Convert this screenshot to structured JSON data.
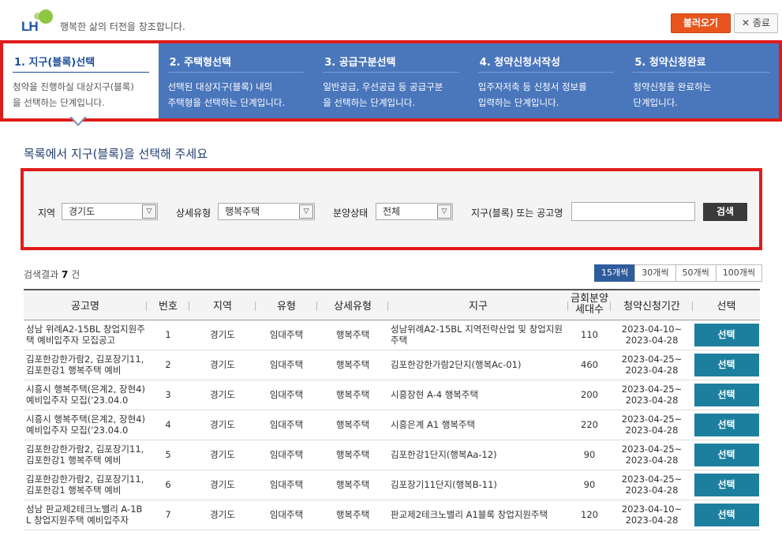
{
  "header": {
    "logo_text": "LH",
    "slogan": "행복한 삶의 터전을 창조합니다.",
    "load_button": "불러오기",
    "close_button": "종료"
  },
  "steps": [
    {
      "title": "1. 지구(블록)선택",
      "desc1": "청약을 진행하실 대상지구(블록)",
      "desc2": "을 선택하는 단계입니다.",
      "active": true
    },
    {
      "title": "2. 주택형선택",
      "desc1": "선택된 대상지구(블록) 내의",
      "desc2": "주택형을 선택하는 단계입니다.",
      "active": false
    },
    {
      "title": "3. 공급구분선택",
      "desc1": "일반공급, 우선공급 등 공급구분",
      "desc2": "을 선택하는 단계입니다.",
      "active": false
    },
    {
      "title": "4. 청약신청서작성",
      "desc1": "입주자저축 등 신청서 정보를",
      "desc2": "입력하는 단계입니다.",
      "active": false
    },
    {
      "title": "5. 청약신청완료",
      "desc1": "청약신청을 완료하는",
      "desc2": "단계입니다.",
      "active": false
    }
  ],
  "section_title": "목록에서 지구(블록)을 선택해 주세요",
  "search": {
    "region_label": "지역",
    "region_value": "경기도",
    "type_label": "상세유형",
    "type_value": "행복주택",
    "status_label": "분양상태",
    "status_value": "전체",
    "keyword_label": "지구(블록) 또는 공고명",
    "keyword_value": "",
    "search_button": "검색"
  },
  "result": {
    "prefix": "검색결과",
    "count": "7",
    "suffix": "건"
  },
  "page_sizes": [
    "15개씩",
    "30개씩",
    "50개씩",
    "100개씩"
  ],
  "table": {
    "headers": {
      "notice": "공고명",
      "no": "번호",
      "region": "지역",
      "type": "유형",
      "subtype": "상세유형",
      "district": "지구",
      "units1": "금회분양",
      "units2": "세대수",
      "period": "청약신청기간",
      "select": "선택"
    },
    "rows": [
      {
        "notice": "성남 위례A2-15BL 창업지원주택 예비입주자 모집공고",
        "no": "1",
        "region": "경기도",
        "type": "임대주택",
        "subtype": "행복주택",
        "district": "성남위례A2-15BL 지역전략산업 및 창업지원주택",
        "units": "110",
        "start": "2023-04-10~",
        "end": "2023-04-28",
        "button": "선택"
      },
      {
        "notice": "김포한강한가람2, 김포장기11, 김포한강1 행복주택 예비",
        "no": "2",
        "region": "경기도",
        "type": "임대주택",
        "subtype": "행복주택",
        "district": "김포한강한가람2단지(행복Ac-01)",
        "units": "460",
        "start": "2023-04-25~",
        "end": "2023-04-28",
        "button": "선택"
      },
      {
        "notice": "시흥시 행복주택(은계2, 장현4) 예비입주자 모집('23.04.0",
        "no": "3",
        "region": "경기도",
        "type": "임대주택",
        "subtype": "행복주택",
        "district": "시흥장현 A-4 행복주택",
        "units": "200",
        "start": "2023-04-25~",
        "end": "2023-04-28",
        "button": "선택"
      },
      {
        "notice": "시흥시 행복주택(은계2, 장현4) 예비입주자 모집('23.04.0",
        "no": "4",
        "region": "경기도",
        "type": "임대주택",
        "subtype": "행복주택",
        "district": "시흥은계 A1 행복주택",
        "units": "220",
        "start": "2023-04-25~",
        "end": "2023-04-28",
        "button": "선택"
      },
      {
        "notice": "김포한강한가람2, 김포장기11, 김포한강1 행복주택 예비",
        "no": "5",
        "region": "경기도",
        "type": "임대주택",
        "subtype": "행복주택",
        "district": "김포한강1단지(행복Aa-12)",
        "units": "90",
        "start": "2023-04-25~",
        "end": "2023-04-28",
        "button": "선택"
      },
      {
        "notice": "김포한강한가람2, 김포장기11, 김포한강1 행복주택 예비",
        "no": "6",
        "region": "경기도",
        "type": "임대주택",
        "subtype": "행복주택",
        "district": "김포장기11단지(행복B-11)",
        "units": "90",
        "start": "2023-04-25~",
        "end": "2023-04-28",
        "button": "선택"
      },
      {
        "notice": "성남 판교제2테크노밸리 A-1BL 창업지원주택 예비입주자",
        "no": "7",
        "region": "경기도",
        "type": "임대주택",
        "subtype": "행복주택",
        "district": "판교제2테크노밸리 A1블록 창업지원주택",
        "units": "120",
        "start": "2023-04-10~",
        "end": "2023-04-28",
        "button": "선택"
      }
    ]
  }
}
